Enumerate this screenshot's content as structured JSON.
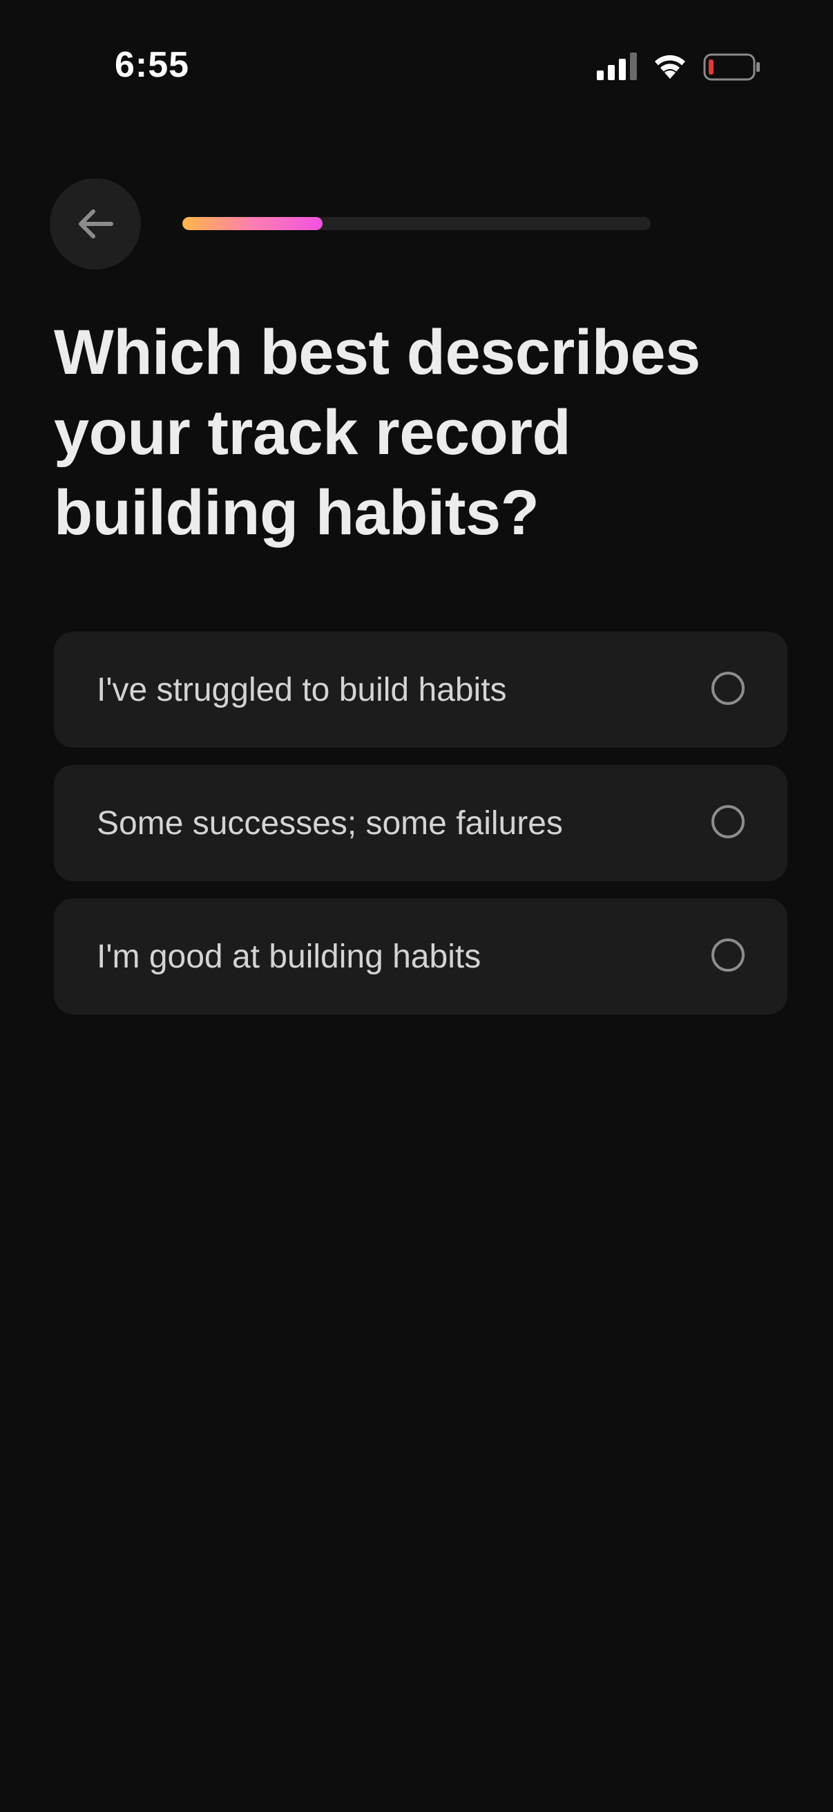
{
  "status_bar": {
    "time": "6:55",
    "battery_color": "#e53935"
  },
  "header": {
    "back_icon": "arrow-left-icon",
    "progress": 0.3,
    "progress_gradient": [
      "#ffb648",
      "#ff7fb0",
      "#f052e0"
    ]
  },
  "question": {
    "title": "Which best describes your track record building habits?"
  },
  "options": [
    {
      "label": "I've struggled to build habits",
      "selected": false
    },
    {
      "label": "Some successes; some failures",
      "selected": false
    },
    {
      "label": "I'm good at building habits",
      "selected": false
    }
  ],
  "theme": {
    "background": "#0d0d0d",
    "card": "#1c1c1c",
    "text": "#ececec"
  }
}
